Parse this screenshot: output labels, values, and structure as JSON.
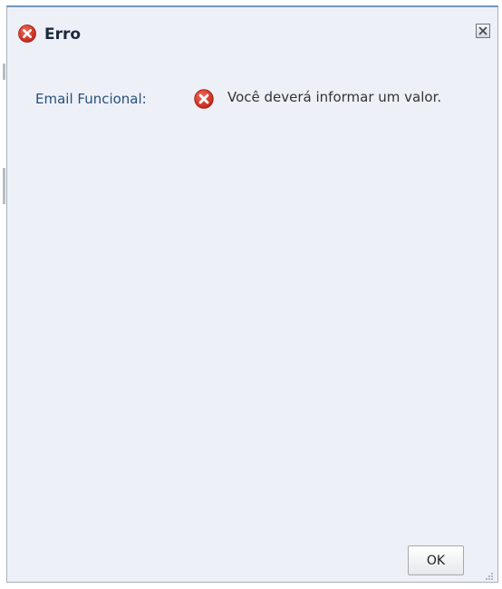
{
  "dialog": {
    "title": "Erro",
    "close_icon": "close-icon",
    "title_icon": "error-icon"
  },
  "message": {
    "field_label": "Email Funcional:",
    "icon": "error-icon",
    "text": "Você deverá informar um valor."
  },
  "buttons": {
    "ok_label": "OK"
  },
  "colors": {
    "error_red": "#d23a2c",
    "label_blue": "#27507b",
    "dialog_bg": "#eef0f8"
  }
}
